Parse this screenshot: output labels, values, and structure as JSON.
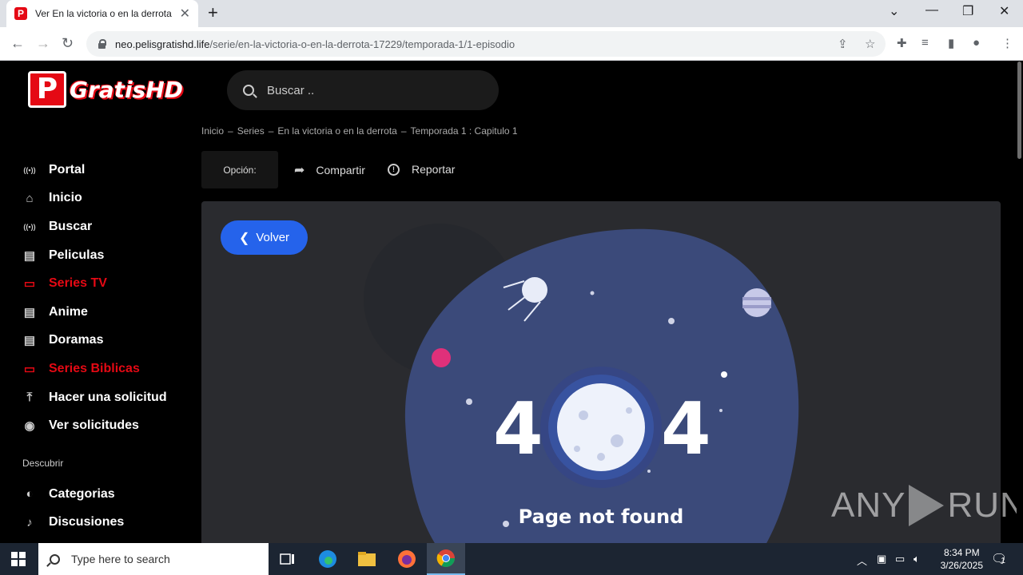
{
  "browser": {
    "tab_title": "Ver En la victoria o en la derrota",
    "url_host": "neo.pelisgratishd.life",
    "url_path": "/serie/en-la-victoria-o-en-la-derrota-17229/temporada-1/1-episodio"
  },
  "site": {
    "logo_letter": "P",
    "logo_text": "GratisHD",
    "search_placeholder": "Buscar .."
  },
  "sidebar": {
    "items": [
      {
        "label": "Portal",
        "icon": "broadcast-icon",
        "active": false
      },
      {
        "label": "Inicio",
        "icon": "home-icon",
        "active": false
      },
      {
        "label": "Buscar",
        "icon": "broadcast-icon",
        "active": false
      },
      {
        "label": "Peliculas",
        "icon": "film-icon",
        "active": false
      },
      {
        "label": "Series TV",
        "icon": "tv-icon",
        "active": true
      },
      {
        "label": "Anime",
        "icon": "film-icon",
        "active": false
      },
      {
        "label": "Doramas",
        "icon": "film-icon",
        "active": false
      },
      {
        "label": "Series Biblicas",
        "icon": "tv-icon",
        "active": true
      },
      {
        "label": "Hacer una solicitud",
        "icon": "upload-icon",
        "active": false
      },
      {
        "label": "Ver solicitudes",
        "icon": "eye-icon",
        "active": false
      }
    ],
    "section_title": "Descubrir",
    "discover": [
      {
        "label": "Categorias",
        "icon": "half-circle-icon"
      },
      {
        "label": "Discusiones",
        "icon": "mic-icon"
      }
    ]
  },
  "breadcrumb": [
    "Inicio",
    "–",
    "Series",
    "–",
    "En la victoria o en la derrota",
    "–",
    "Temporada 1 : Capitulo 1"
  ],
  "actions": {
    "options_label": "Opción:",
    "share_label": "Compartir",
    "report_label": "Reportar"
  },
  "error": {
    "back_label": "Volver",
    "digit_left": "4",
    "digit_right": "4",
    "message": "Page not found"
  },
  "watermark": {
    "left": "ANY",
    "right": "RUN"
  },
  "taskbar": {
    "search_placeholder": "Type here to search",
    "time": "8:34 PM",
    "date": "3/26/2025",
    "notif_count": "1"
  },
  "colors": {
    "accent_red": "#e50914",
    "button_blue": "#2563eb",
    "panel_bg": "#2a2b2f",
    "blob": "#3b4a7a"
  }
}
